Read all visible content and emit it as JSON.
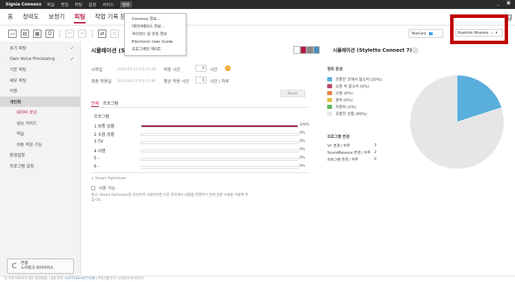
{
  "titlebar": {
    "app_name": "Signia Connexx",
    "menu": [
      "파일",
      "편집",
      "피팅",
      "설정",
      "서비스",
      "정보"
    ],
    "active_menu_index": 5,
    "min_icon": "_",
    "restore_icon": "▣"
  },
  "tabs": [
    "홈",
    "청력도",
    "보청기",
    "피팅",
    "작업 기록 문서"
  ],
  "active_tab_index": 3,
  "brand_tail": "ig",
  "help_menu": {
    "items": [
      "Connexx 정보...",
      "데이터베이스 정보...",
      "라이센스 및 상표 정보",
      "Electronic User Guide",
      "프로그래밍 게이트"
    ]
  },
  "toolbar": {
    "telecare_label": "TeleCare",
    "wireless_label": "Noahlink Wireless"
  },
  "sidebar": {
    "items": [
      {
        "label": "초기 피팅",
        "checked": true
      },
      {
        "label": "Own Voice Processing",
        "checked": true
      },
      {
        "label": "기본 피팅",
        "checked": false
      },
      {
        "label": "세부 피팅",
        "checked": false
      },
      {
        "label": "이명",
        "checked": false
      },
      {
        "label": "개인화",
        "checked": false
      }
    ],
    "subitems": [
      "데이터 로깅",
      "성능 가이드",
      "학습",
      "자동 적응 기능"
    ],
    "after_items": [
      "환경설정",
      "프로그램 설정"
    ],
    "bottom_button": {
      "line1": "연결",
      "line2": "노아링크 와이어리스"
    }
  },
  "main": {
    "title": "시뮬레이션 (St",
    "start_label": "시작일",
    "start_value": "2020-03-13 오전 11:24",
    "wear_time_label": "착용 시간",
    "wear_time_value": "1",
    "wear_time_unit": "시간",
    "last_wear_label": "최종 착용일",
    "last_wear_value": "2020-03-13 오전 11:42",
    "avg_wear_label": "평균 착용 시간",
    "avg_wear_value": "1",
    "avg_wear_unit": "시간 / 하루",
    "reset_label": "Reset",
    "subtabs": [
      "전체",
      "프로그램"
    ],
    "program_label": "프로그램",
    "programs": [
      {
        "name": "1 보통 상황",
        "percent": 100,
        "pct_text": "100%"
      },
      {
        "name": "2 소음 상황",
        "percent": 0,
        "pct_text": "0%"
      },
      {
        "name": "3 TV",
        "percent": 0,
        "pct_text": "0%"
      },
      {
        "name": "4 이명",
        "percent": 0,
        "pct_text": "0%"
      },
      {
        "name": "5 -",
        "percent": 0,
        "pct_text": "0%"
      },
      {
        "name": "6 -",
        "percent": 0,
        "pct_text": "0%"
      }
    ],
    "smart_optimizer": "Smart Optimizer",
    "usable_label": "사용 가능",
    "note": "참고: Smart Optimizer를 완전하게 사용하려면 다른 위치에서 내용을 변경하기 전에 권장 사항을 적용해 주십시오."
  },
  "right": {
    "title": "시뮬레이션 (Styletto Connect 7)",
    "env_label": "청취 환경",
    "env_items": [
      {
        "label": "조용한 곳에서 말소리 (20%)",
        "color": "#5aaedc"
      },
      {
        "label": "소음 속 말소리 (0%)",
        "color": "#b94a6f"
      },
      {
        "label": "소음 (0%)",
        "color": "#e8874a"
      },
      {
        "label": "음악 (0%)",
        "color": "#e0c040"
      },
      {
        "label": "자동차 (0%)",
        "color": "#5fb85f"
      },
      {
        "label": "조용한 상황 (80%)",
        "color": "#e6e6e6"
      }
    ],
    "prog_change_label": "프로그램 변경",
    "stats": [
      {
        "label": "VC 변경 / 하루",
        "value": "3"
      },
      {
        "label": "SoundBalance 변경 / 하루",
        "value": "2"
      },
      {
        "label": "프로그램 변경 / 하루",
        "value": "0"
      }
    ],
    "pie": {
      "values": [
        20,
        80
      ],
      "colors": [
        "#5aaedc",
        "#e6e6e6"
      ]
    }
  },
  "statusbar": {
    "text": "더 가까 (바보하기 않은 경선발생) | 일련 번호:",
    "serial1": "AU77149",
    "serial2": "AU77108",
    "tail": "| 프로그램 장치: 노아링크 와이어리스"
  }
}
